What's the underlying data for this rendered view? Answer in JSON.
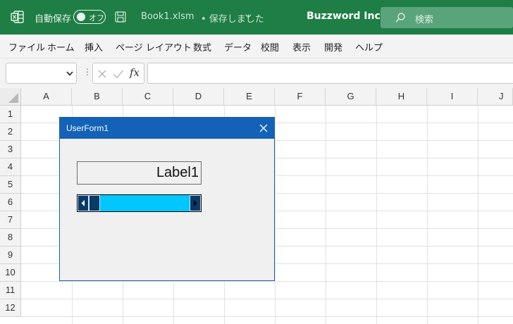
{
  "titlebar": {
    "autosave_label": "自動保存",
    "autosave_toggle": "オフ",
    "document_name": "Book1.xlsm",
    "document_status": "• 保存しました",
    "brand": "Buzzword Inc.",
    "search_placeholder": "検索",
    "accent_color": "#1e7e45"
  },
  "menu": {
    "items": [
      "ファイル",
      "ホーム",
      "挿入",
      "ページ レイアウト",
      "数式",
      "データ",
      "校閲",
      "表示",
      "開発",
      "ヘルプ"
    ]
  },
  "formula_bar": {
    "name_box_value": "",
    "fx_label": "fx",
    "formula_value": ""
  },
  "sheet": {
    "columns": [
      "A",
      "B",
      "C",
      "D",
      "E",
      "F",
      "G",
      "H",
      "I",
      "J"
    ],
    "rows": [
      "1",
      "2",
      "3",
      "4",
      "5",
      "6",
      "7",
      "8",
      "9",
      "10",
      "11",
      "12"
    ]
  },
  "userform": {
    "title": "UserForm1",
    "label_text": "Label1",
    "scrollbar": {
      "value_fraction": 0,
      "track_color": "#00c8ff",
      "button_color": "#0a3a66"
    }
  }
}
